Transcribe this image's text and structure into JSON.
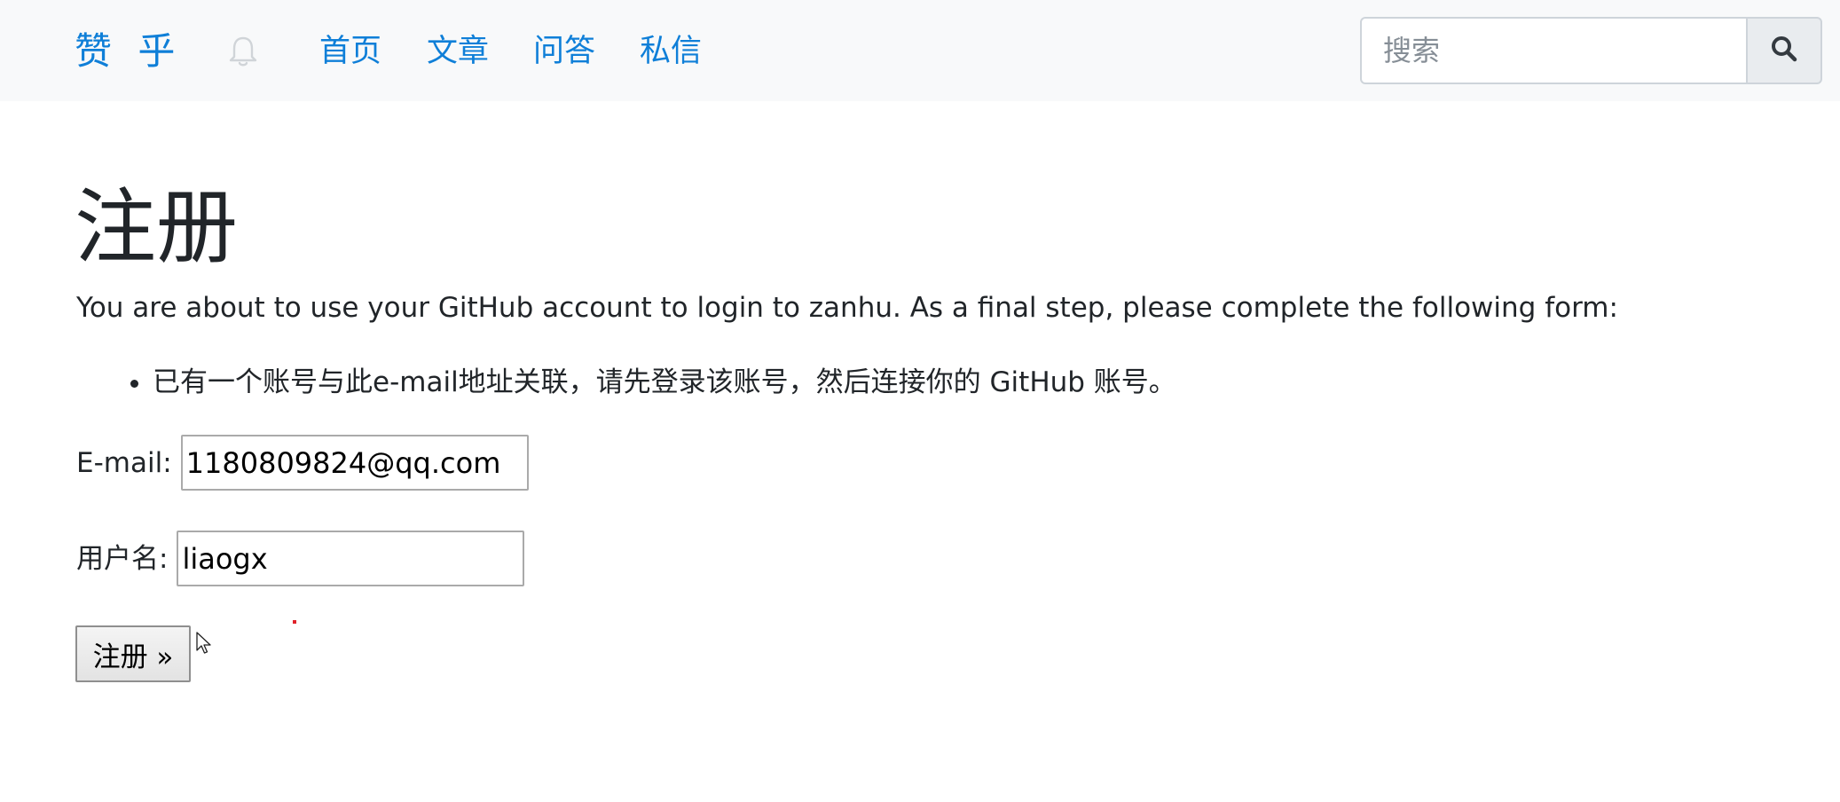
{
  "navbar": {
    "brand": "赞 乎",
    "bell_icon": "bell-icon",
    "links": [
      "首页",
      "文章",
      "问答",
      "私信"
    ],
    "search": {
      "placeholder": "搜索",
      "value": "",
      "icon": "search-icon"
    }
  },
  "main": {
    "title": "注册",
    "intro": "You are about to use your GitHub account to login to zanhu. As a final step, please complete the following form:",
    "notices": [
      "已有一个账号与此e-mail地址关联，请先登录该账号，然后连接你的 GitHub 账号。"
    ],
    "form": {
      "email_label": "E-mail:",
      "email_value": "1180809824@qq.com",
      "username_label": "用户名:",
      "username_value": "liaogx",
      "submit_label": "注册 »"
    }
  },
  "colors": {
    "brand": "#0f7fd8",
    "navbar_bg": "#f8f9fa",
    "text": "#212529"
  }
}
